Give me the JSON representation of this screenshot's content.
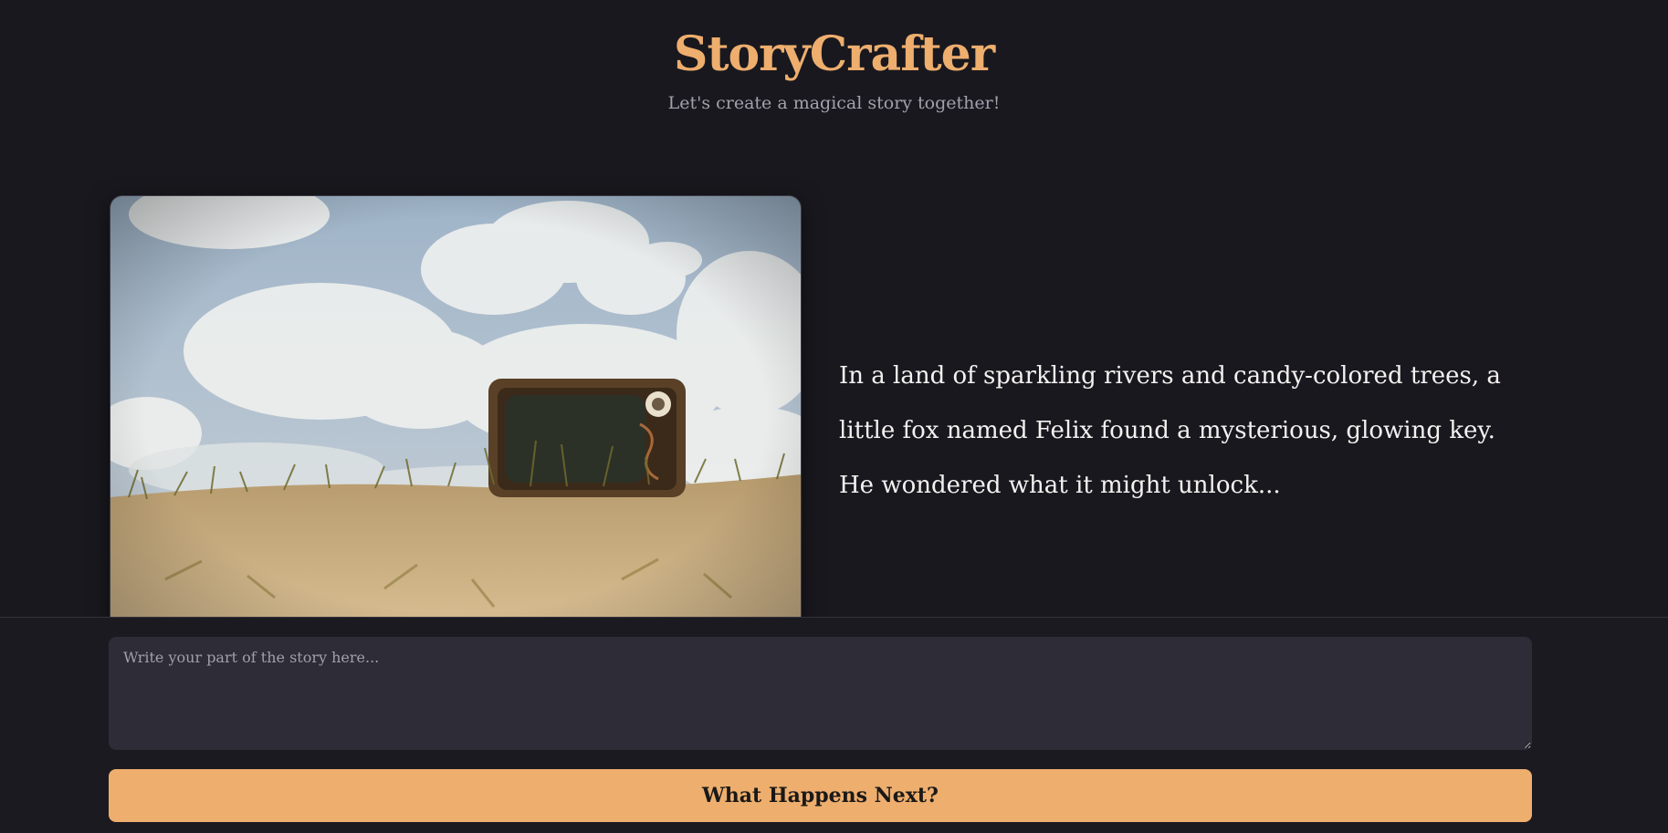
{
  "app": {
    "title": "StoryCrafter",
    "subtitle": "Let's create a magical story together!"
  },
  "story": {
    "text": "In a land of sparkling rivers and candy-colored trees, a little fox named Felix found a mysterious, glowing key. He wondered what it might unlock..."
  },
  "composer": {
    "placeholder": "Write your part of the story here...",
    "value": "",
    "submit_label": "What Happens Next?"
  },
  "colors": {
    "background": "#19181e",
    "accent": "#eeae6e",
    "input_background": "#2d2c37"
  }
}
